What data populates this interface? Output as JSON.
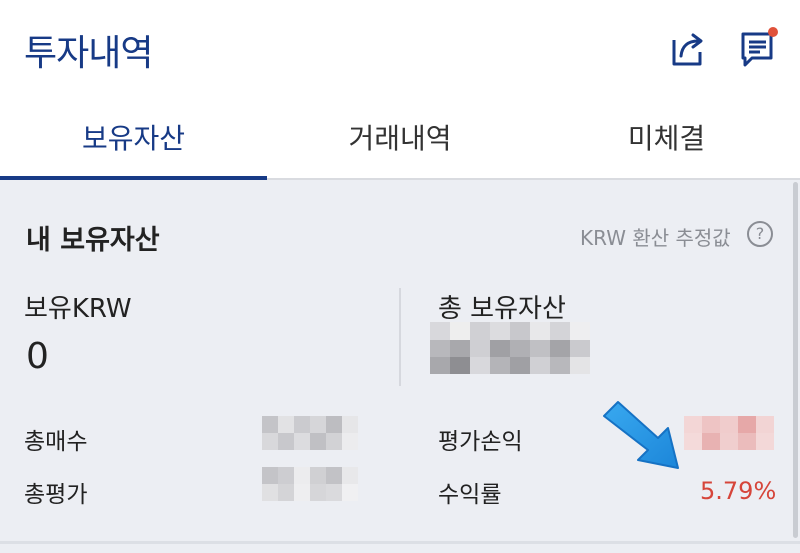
{
  "header": {
    "title": "투자내역",
    "share_icon": "share-icon",
    "memo_icon": "memo-icon",
    "notification_dot_color": "#e0513a"
  },
  "tabs": [
    {
      "label": "보유자산",
      "active": true
    },
    {
      "label": "거래내역",
      "active": false
    },
    {
      "label": "미체결",
      "active": false
    }
  ],
  "summary": {
    "title": "내 보유자산",
    "krw_note": "KRW 환산 추정값",
    "help_icon": "?",
    "krw_label": "보유KRW",
    "krw_value": "0",
    "total_label": "총 보유자산",
    "rows": [
      {
        "label": "총매수"
      },
      {
        "label": "총평가"
      },
      {
        "label": "평가손익"
      },
      {
        "label": "수익률",
        "value": "5.79%"
      }
    ]
  },
  "colors": {
    "brand": "#173a86",
    "profit": "#d6453a",
    "panel_bg": "#eceef3",
    "arrow": "#2f9be8"
  }
}
